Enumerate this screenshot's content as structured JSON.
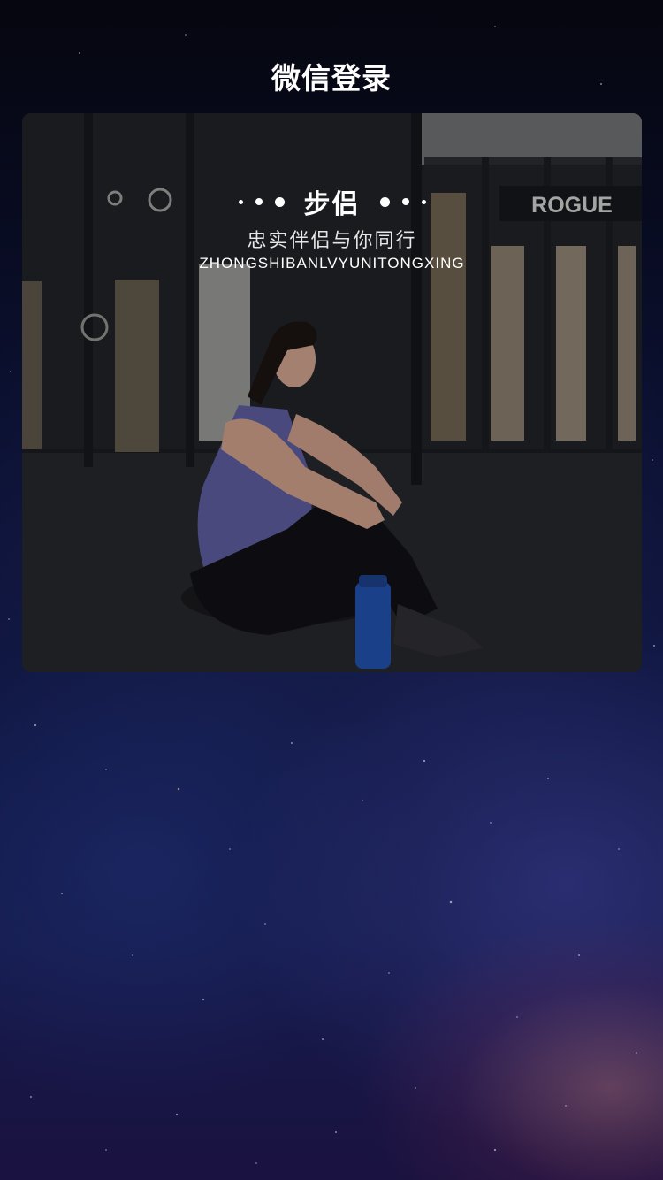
{
  "header": {
    "title": "微信登录"
  },
  "hero": {
    "brand_name": "步侣",
    "slogan_cn": "忠实伴侣与你同行",
    "slogan_pinyin": "ZHONGSHIBANLVYUNITONGXING",
    "gym_sign_text": "ROGUE"
  },
  "colors": {
    "background_top": "#05060f",
    "background_mid": "#111845",
    "nebula_accent": "#e28678",
    "text_primary": "#ffffff"
  }
}
